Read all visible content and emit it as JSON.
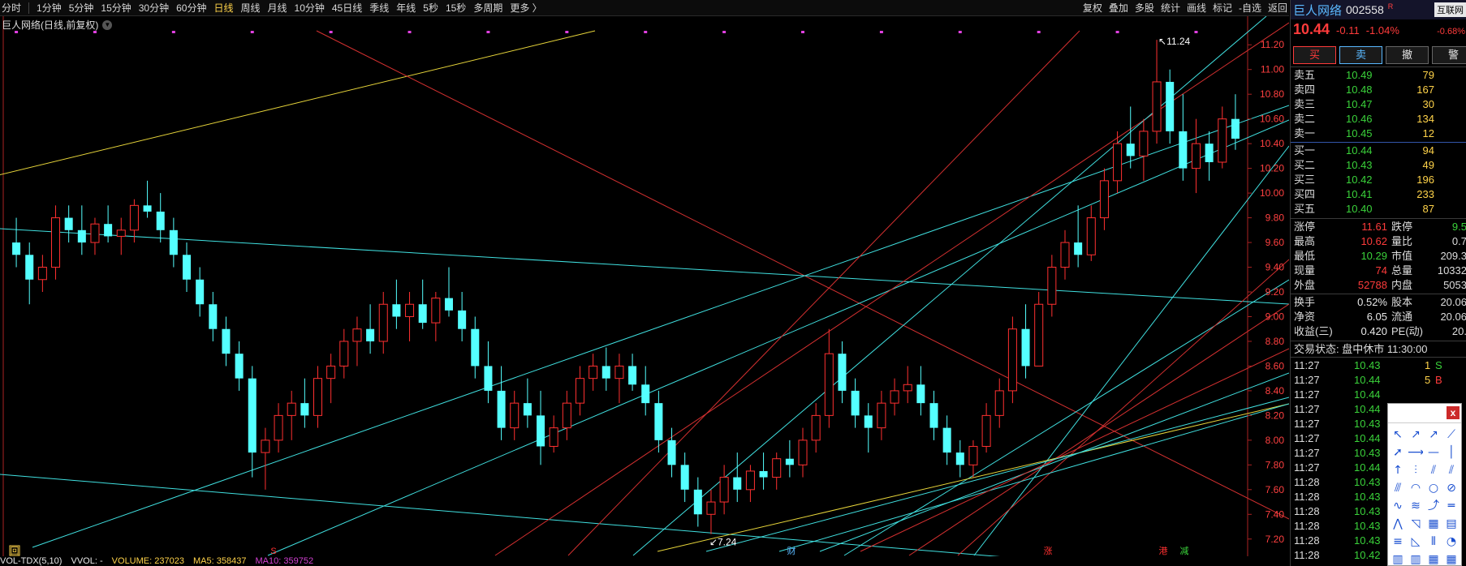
{
  "toolbar": {
    "periods": [
      "分时",
      "1分钟",
      "5分钟",
      "15分钟",
      "30分钟",
      "60分钟",
      "日线",
      "周线",
      "月线",
      "10分钟",
      "45日线",
      "季线",
      "年线",
      "5秒",
      "15秒",
      "多周期",
      "更多 〉"
    ],
    "active_period": "日线",
    "right": [
      "复权",
      "叠加",
      "多股",
      "统计",
      "画线",
      "标记",
      "-自选",
      "返回"
    ]
  },
  "chart_title": "巨人网络(日线,前复权)",
  "chart_data": {
    "type": "candlestick",
    "price_axis": [
      "11.20",
      "11.00",
      "10.80",
      "10.60",
      "10.40",
      "10.20",
      "10.00",
      "9.80",
      "9.60",
      "9.40",
      "9.20",
      "9.00",
      "8.80",
      "8.60",
      "8.40",
      "8.20",
      "8.00",
      "7.80",
      "7.60",
      "7.40",
      "7.20"
    ],
    "ylim": [
      7.1,
      11.3
    ],
    "high_label": "11.24",
    "low_label": "7.24",
    "markers": [
      "S",
      "财",
      "涨",
      "港",
      "减"
    ],
    "ohlc": [
      [
        9.6,
        9.8,
        9.4,
        9.5
      ],
      [
        9.5,
        9.6,
        9.1,
        9.3
      ],
      [
        9.3,
        9.5,
        9.2,
        9.4
      ],
      [
        9.4,
        9.9,
        9.3,
        9.8
      ],
      [
        9.8,
        9.9,
        9.6,
        9.7
      ],
      [
        9.7,
        9.9,
        9.5,
        9.6
      ],
      [
        9.6,
        9.8,
        9.5,
        9.75
      ],
      [
        9.75,
        9.9,
        9.6,
        9.65
      ],
      [
        9.65,
        9.8,
        9.5,
        9.7
      ],
      [
        9.7,
        9.95,
        9.6,
        9.9
      ],
      [
        9.9,
        10.1,
        9.8,
        9.85
      ],
      [
        9.85,
        10.0,
        9.6,
        9.7
      ],
      [
        9.7,
        9.8,
        9.4,
        9.5
      ],
      [
        9.5,
        9.6,
        9.2,
        9.3
      ],
      [
        9.3,
        9.4,
        9.0,
        9.1
      ],
      [
        9.1,
        9.2,
        8.8,
        8.9
      ],
      [
        8.9,
        9.0,
        8.6,
        8.7
      ],
      [
        8.7,
        8.8,
        8.4,
        8.5
      ],
      [
        8.5,
        8.6,
        7.7,
        7.9
      ],
      [
        7.9,
        8.1,
        7.6,
        8.0
      ],
      [
        8.0,
        8.3,
        7.9,
        8.2
      ],
      [
        8.2,
        8.4,
        8.0,
        8.3
      ],
      [
        8.3,
        8.5,
        8.1,
        8.2
      ],
      [
        8.2,
        8.6,
        8.1,
        8.5
      ],
      [
        8.5,
        8.7,
        8.3,
        8.6
      ],
      [
        8.6,
        8.9,
        8.5,
        8.8
      ],
      [
        8.8,
        9.0,
        8.6,
        8.9
      ],
      [
        8.9,
        9.1,
        8.7,
        8.8
      ],
      [
        8.8,
        9.2,
        8.7,
        9.1
      ],
      [
        9.1,
        9.3,
        8.9,
        9.0
      ],
      [
        9.0,
        9.2,
        8.8,
        9.1
      ],
      [
        9.1,
        9.3,
        8.9,
        8.95
      ],
      [
        8.95,
        9.2,
        8.8,
        9.15
      ],
      [
        9.15,
        9.4,
        9.0,
        9.05
      ],
      [
        9.05,
        9.2,
        8.8,
        8.9
      ],
      [
        8.9,
        9.0,
        8.5,
        8.6
      ],
      [
        8.6,
        8.8,
        8.3,
        8.4
      ],
      [
        8.4,
        8.6,
        8.0,
        8.1
      ],
      [
        8.1,
        8.4,
        8.0,
        8.3
      ],
      [
        8.3,
        8.5,
        8.1,
        8.2
      ],
      [
        8.2,
        8.4,
        7.8,
        7.95
      ],
      [
        7.95,
        8.2,
        7.9,
        8.1
      ],
      [
        8.1,
        8.4,
        8.0,
        8.3
      ],
      [
        8.3,
        8.6,
        8.2,
        8.5
      ],
      [
        8.5,
        8.7,
        8.4,
        8.6
      ],
      [
        8.6,
        8.75,
        8.4,
        8.5
      ],
      [
        8.5,
        8.7,
        8.3,
        8.6
      ],
      [
        8.6,
        8.7,
        8.4,
        8.45
      ],
      [
        8.45,
        8.6,
        8.2,
        8.3
      ],
      [
        8.3,
        8.4,
        7.9,
        8.0
      ],
      [
        8.0,
        8.1,
        7.7,
        7.8
      ],
      [
        7.8,
        7.9,
        7.5,
        7.6
      ],
      [
        7.6,
        7.7,
        7.3,
        7.4
      ],
      [
        7.4,
        7.6,
        7.24,
        7.5
      ],
      [
        7.5,
        7.8,
        7.4,
        7.7
      ],
      [
        7.7,
        7.9,
        7.5,
        7.6
      ],
      [
        7.6,
        7.8,
        7.5,
        7.75
      ],
      [
        7.75,
        7.9,
        7.6,
        7.7
      ],
      [
        7.7,
        7.9,
        7.6,
        7.85
      ],
      [
        7.85,
        8.0,
        7.7,
        7.8
      ],
      [
        7.8,
        8.1,
        7.7,
        8.0
      ],
      [
        8.0,
        8.3,
        7.9,
        8.2
      ],
      [
        8.2,
        8.9,
        8.1,
        8.7
      ],
      [
        8.7,
        8.8,
        8.3,
        8.4
      ],
      [
        8.4,
        8.5,
        8.1,
        8.2
      ],
      [
        8.2,
        8.3,
        7.9,
        8.1
      ],
      [
        8.1,
        8.4,
        8.0,
        8.3
      ],
      [
        8.3,
        8.5,
        8.2,
        8.4
      ],
      [
        8.4,
        8.6,
        8.3,
        8.45
      ],
      [
        8.45,
        8.6,
        8.2,
        8.3
      ],
      [
        8.3,
        8.4,
        8.0,
        8.1
      ],
      [
        8.1,
        8.2,
        7.8,
        7.9
      ],
      [
        7.9,
        8.0,
        7.7,
        7.8
      ],
      [
        7.8,
        8.0,
        7.7,
        7.95
      ],
      [
        7.95,
        8.3,
        7.9,
        8.2
      ],
      [
        8.2,
        8.5,
        8.1,
        8.4
      ],
      [
        8.4,
        9.0,
        8.3,
        8.9
      ],
      [
        8.9,
        9.1,
        8.5,
        8.6
      ],
      [
        8.6,
        9.2,
        8.6,
        9.1
      ],
      [
        9.1,
        9.5,
        9.0,
        9.4
      ],
      [
        9.4,
        9.7,
        9.3,
        9.6
      ],
      [
        9.6,
        9.9,
        9.4,
        9.5
      ],
      [
        9.5,
        9.9,
        9.45,
        9.8
      ],
      [
        9.8,
        10.2,
        9.7,
        10.1
      ],
      [
        10.1,
        10.5,
        10.0,
        10.4
      ],
      [
        10.4,
        10.7,
        10.2,
        10.3
      ],
      [
        10.3,
        10.6,
        10.1,
        10.5
      ],
      [
        10.5,
        11.24,
        10.4,
        10.9
      ],
      [
        10.9,
        11.0,
        10.4,
        10.5
      ],
      [
        10.5,
        10.8,
        10.1,
        10.2
      ],
      [
        10.2,
        10.6,
        10.0,
        10.4
      ],
      [
        10.4,
        10.5,
        10.1,
        10.25
      ],
      [
        10.25,
        10.7,
        10.2,
        10.6
      ],
      [
        10.6,
        10.8,
        10.35,
        10.44
      ]
    ]
  },
  "volume_bar": {
    "label": "VOL-TDX(5,10)",
    "vol": "VVOL: -",
    "volume": "VOLUME: 237023",
    "ma5": "MA5: 358437",
    "ma10": "MA10: 359752"
  },
  "quote": {
    "name": "巨人网络",
    "code": "002558",
    "badge": "R",
    "keyword": "互联网",
    "price": "10.44",
    "change": "-0.11",
    "pct": "-1.04%",
    "sector_pct": "-0.68%",
    "buttons": [
      "买",
      "卖",
      "撤",
      "警"
    ],
    "asks": [
      {
        "label": "卖五",
        "price": "10.49",
        "vol": "79"
      },
      {
        "label": "卖四",
        "price": "10.48",
        "vol": "167"
      },
      {
        "label": "卖三",
        "price": "10.47",
        "vol": "30"
      },
      {
        "label": "卖二",
        "price": "10.46",
        "vol": "134"
      },
      {
        "label": "卖一",
        "price": "10.45",
        "vol": "12"
      }
    ],
    "bids": [
      {
        "label": "买一",
        "price": "10.44",
        "vol": "94"
      },
      {
        "label": "买二",
        "price": "10.43",
        "vol": "49"
      },
      {
        "label": "买三",
        "price": "10.42",
        "vol": "196"
      },
      {
        "label": "买四",
        "price": "10.41",
        "vol": "233"
      },
      {
        "label": "买五",
        "price": "10.40",
        "vol": "87"
      }
    ],
    "stats": [
      {
        "a": "涨停",
        "b": "11.61",
        "c": "跌停",
        "d": "9.5"
      },
      {
        "a": "最高",
        "b": "10.62",
        "c": "量比",
        "d": "0.7"
      },
      {
        "a": "最低",
        "b": "10.29",
        "c": "市值",
        "d": "209.3"
      },
      {
        "a": "现量",
        "b": "74",
        "c": "总量",
        "d": "10332"
      },
      {
        "a": "外盘",
        "b": "52788",
        "c": "内盘",
        "d": "5053"
      }
    ],
    "stats2": [
      {
        "a": "换手",
        "b": "0.52%",
        "c": "股本",
        "d": "20.06"
      },
      {
        "a": "净资",
        "b": "6.05",
        "c": "流通",
        "d": "20.06"
      },
      {
        "a": "收益(三)",
        "b": "0.420",
        "c": "PE(动)",
        "d": "20."
      }
    ],
    "trade_status": "交易状态: 盘中休市 11:30:00",
    "ticks": [
      {
        "t": "11:27",
        "p": "10.43",
        "v": "1",
        "f": "S"
      },
      {
        "t": "11:27",
        "p": "10.44",
        "v": "5",
        "f": "B"
      },
      {
        "t": "11:27",
        "p": "10.44",
        "v": "",
        "f": ""
      },
      {
        "t": "11:27",
        "p": "10.44",
        "v": "",
        "f": ""
      },
      {
        "t": "11:27",
        "p": "10.43",
        "v": "",
        "f": ""
      },
      {
        "t": "11:27",
        "p": "10.44",
        "v": "",
        "f": ""
      },
      {
        "t": "11:27",
        "p": "10.43",
        "v": "",
        "f": ""
      },
      {
        "t": "11:27",
        "p": "10.44",
        "v": "",
        "f": ""
      },
      {
        "t": "11:28",
        "p": "10.43",
        "v": "",
        "f": ""
      },
      {
        "t": "11:28",
        "p": "10.43",
        "v": "",
        "f": ""
      },
      {
        "t": "11:28",
        "p": "10.43",
        "v": "",
        "f": ""
      },
      {
        "t": "11:28",
        "p": "10.43",
        "v": "",
        "f": ""
      },
      {
        "t": "11:28",
        "p": "10.43",
        "v": "",
        "f": ""
      },
      {
        "t": "11:28",
        "p": "10.42",
        "v": "",
        "f": ""
      }
    ]
  },
  "tool_palette": {
    "close": "x",
    "tools": [
      "cursor-icon",
      "line-segment-icon",
      "ray-icon",
      "straight-line-icon",
      "arrow-line-icon",
      "horizontal-ray-icon",
      "horizontal-line-icon",
      "vertical-line-icon",
      "arrow-up-icon",
      "fibonacci-icon",
      "parallel-line-icon",
      "parallel-channel-icon",
      "trend-channel-icon",
      "arc-icon",
      "circle-icon",
      "no-entry-icon",
      "wave-icon",
      "wave-alt-icon",
      "up-wave-icon",
      "price-line-icon",
      "zigzag-icon",
      "gann-fan-icon",
      "gann-box-icon",
      "gann-grid-icon",
      "fib-retrace-icon",
      "fib-fan-icon",
      "fib-time-icon",
      "fib-arc-icon",
      "bars-icon",
      "bars-alt-icon",
      "bars-grid-icon",
      "bars-grid-alt-icon"
    ]
  }
}
